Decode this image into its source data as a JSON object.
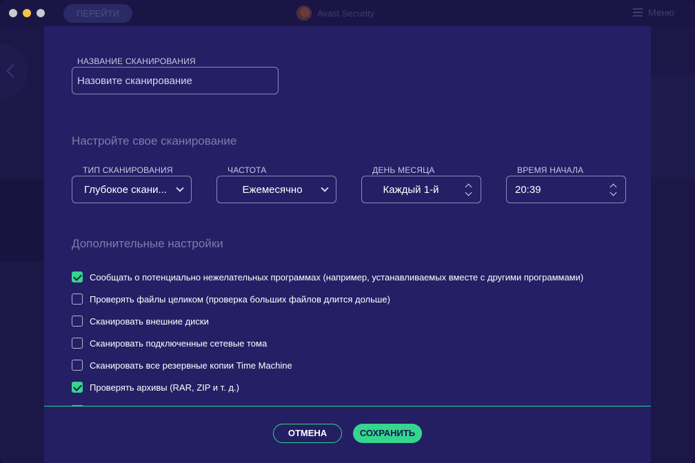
{
  "window": {
    "title": "Avast Security",
    "go_button": "ПЕРЕЙТИ",
    "menu_label": "Меню"
  },
  "form": {
    "name_label": "НАЗВАНИЕ СКАНИРОВАНИЯ",
    "name_placeholder": "Назовите сканирование",
    "configure_title": "Настройте свое сканирование",
    "scan_type": {
      "label": "ТИП СКАНИРОВАНИЯ",
      "value": "Глубокое скани..."
    },
    "frequency": {
      "label": "ЧАСТОТА",
      "value": "Ежемесячно"
    },
    "day_of_month": {
      "label": "ДЕНЬ МЕСЯЦА",
      "value": "Каждый 1-й"
    },
    "start_time": {
      "label": "ВРЕМЯ НАЧАЛА",
      "value": "20:39"
    },
    "advanced_title": "Дополнительные настройки",
    "options": [
      {
        "label": "Сообщать о потенциально нежелательных программах (например, устанавливаемых вместе с другими программами)",
        "checked": true
      },
      {
        "label": "Проверять файлы целиком (проверка больших файлов длится дольше)",
        "checked": false
      },
      {
        "label": "Сканировать внешние диски",
        "checked": false
      },
      {
        "label": "Сканировать подключенные сетевые тома",
        "checked": false
      },
      {
        "label": "Сканировать все резервные копии Time Machine",
        "checked": false
      },
      {
        "label": "Проверять архивы (RAR, ZIP и т. д.)",
        "checked": true
      }
    ]
  },
  "footer": {
    "cancel_label": "ОТМЕНА",
    "save_label": "СОХРАНИТЬ"
  },
  "colors": {
    "sheet_bg": "#251f66",
    "accent": "#34d68e",
    "background": "#1c1747"
  }
}
